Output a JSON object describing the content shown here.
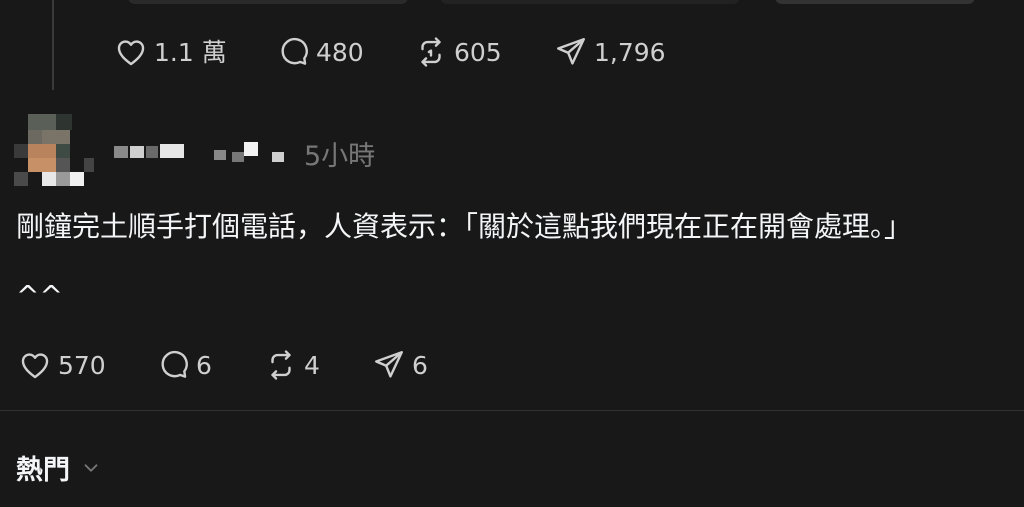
{
  "previous_post": {
    "likes": "1.1 萬",
    "replies": "480",
    "reposts": "605",
    "shares": "1,796"
  },
  "post": {
    "author_name": "",
    "timestamp": "5小時",
    "text_line1": "剛鐘完土順手打個電話，人資表示：「關於這點我們現在正在開會處理。」",
    "text_line2": "^^",
    "likes": "570",
    "replies": "6",
    "reposts": "4",
    "shares": "6"
  },
  "sort": {
    "label": "熱門"
  },
  "icons": {
    "like": "heart-icon",
    "reply": "comment-icon",
    "repost": "repost-icon",
    "share": "share-icon",
    "sort": "chevron-down-icon"
  },
  "colors": {
    "background": "#181818",
    "text": "#f3f5f7",
    "muted": "#777777",
    "icon": "#cfcfcf",
    "divider": "#333333"
  }
}
